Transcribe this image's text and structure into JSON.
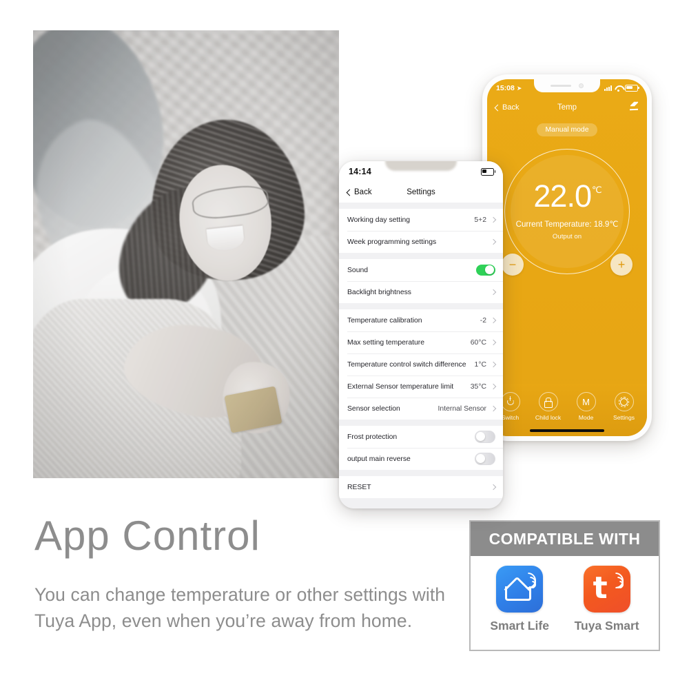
{
  "headline": "App Control",
  "body_copy": "You can change temperature or other settings with Tuya App, even when you’re away from home.",
  "photo": {
    "alt": "woman lying on rug using orange smart thermostat app on phone"
  },
  "settings_phone": {
    "status": {
      "time": "14:14",
      "battery_icon": "battery-low-icon"
    },
    "nav": {
      "back": "Back",
      "title": "Settings"
    },
    "groups": [
      {
        "rows": [
          {
            "label": "Working day setting",
            "value": "5+2",
            "control": "chevron"
          },
          {
            "label": "Week programming settings",
            "value": "",
            "control": "chevron"
          }
        ]
      },
      {
        "rows": [
          {
            "label": "Sound",
            "value": "",
            "control": "toggle-on"
          },
          {
            "label": "Backlight brightness",
            "value": "",
            "control": "chevron"
          }
        ]
      },
      {
        "rows": [
          {
            "label": "Temperature calibration",
            "value": "-2",
            "control": "chevron"
          },
          {
            "label": "Max setting temperature",
            "value": "60°C",
            "control": "chevron"
          },
          {
            "label": "Temperature control switch difference",
            "value": "1°C",
            "control": "chevron"
          },
          {
            "label": "External Sensor temperature limit",
            "value": "35°C",
            "control": "chevron"
          },
          {
            "label": "Sensor selection",
            "value": "Internal Sensor",
            "control": "chevron"
          }
        ]
      },
      {
        "rows": [
          {
            "label": "Frost protection",
            "value": "",
            "control": "toggle-off"
          },
          {
            "label": "output main reverse",
            "value": "",
            "control": "toggle-off"
          }
        ]
      },
      {
        "rows": [
          {
            "label": "RESET",
            "value": "",
            "control": "chevron"
          }
        ]
      }
    ]
  },
  "temp_phone": {
    "accent_color": "#e8a714",
    "status": {
      "time": "15:08",
      "location_icon": "location-arrow-icon",
      "signal_icon": "cellular-signal-icon",
      "wifi_icon": "wifi-icon",
      "battery_icon": "battery-icon"
    },
    "nav": {
      "back": "Back",
      "title": "Temp",
      "edit_icon": "pencil-icon"
    },
    "mode_pill": "Manual mode",
    "dial": {
      "target_temperature": "22.0",
      "unit": "℃",
      "current_temperature": "Current Temperature: 18.9℃",
      "output_state": "Output on",
      "minus_label": "−",
      "plus_label": "+"
    },
    "tabs": [
      {
        "label": "Switch",
        "icon": "power-icon"
      },
      {
        "label": "Child lock",
        "icon": "lock-icon"
      },
      {
        "label": "Mode",
        "icon": "mode-m-icon"
      },
      {
        "label": "Settings",
        "icon": "gear-icon"
      }
    ]
  },
  "compatible": {
    "header": "COMPATIBLE WITH",
    "header_bg": "#8c8c8c",
    "apps": [
      {
        "name": "Smart Life",
        "icon": "smart-life-app-icon",
        "color": "#2f7fe8"
      },
      {
        "name": "Tuya Smart",
        "icon": "tuya-smart-app-icon",
        "color": "#f3591f"
      }
    ]
  }
}
